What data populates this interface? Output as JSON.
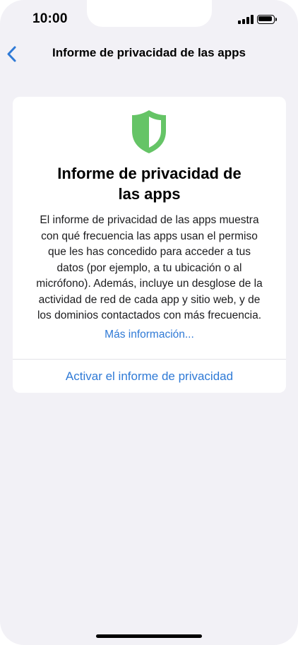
{
  "status_bar": {
    "time": "10:00"
  },
  "nav": {
    "back_icon": "chevron-left-icon",
    "title": "Informe de privacidad de las apps"
  },
  "card": {
    "icon": "shield-icon",
    "title_line1": "Informe de privacidad de",
    "title_line2": "las apps",
    "body_lines": [
      "El informe de privacidad de las apps muestra",
      "con qué frecuencia las apps usan el permiso",
      "que les has concedido para acceder a tus",
      "datos (por ejemplo, a tu ubicación o al",
      "micrófono). Además, incluye un desglose de la",
      "actividad de red de cada app y sitio web, y de",
      "los dominios contactados con más frecuencia."
    ],
    "more_link": "Más información...",
    "activate_button": "Activar el informe de privacidad"
  },
  "colors": {
    "accent": "#2f7ad6",
    "shield_green": "#65c466",
    "background": "#f2f1f6"
  }
}
